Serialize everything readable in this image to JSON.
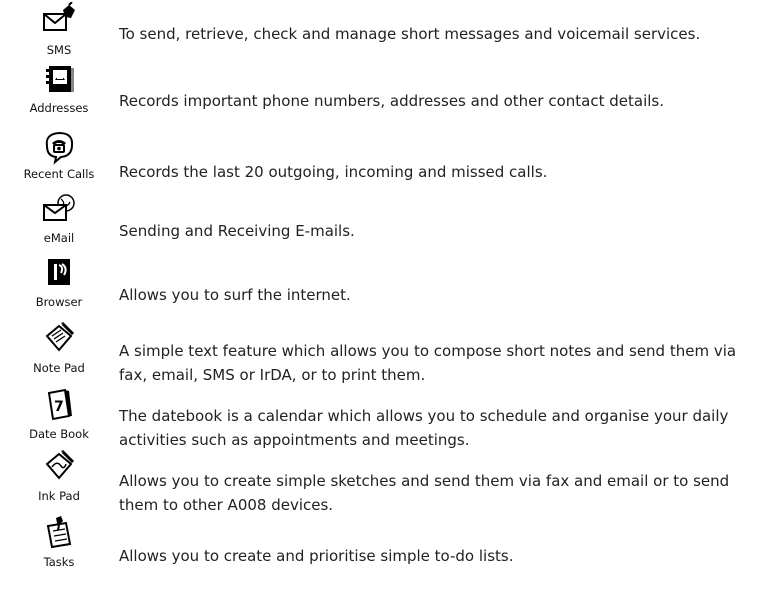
{
  "items": [
    {
      "label": "SMS",
      "icon": "sms-envelope-icon",
      "description": "To send, retrieve, check and manage short messages and voicemail services."
    },
    {
      "label": "Addresses",
      "icon": "address-book-icon",
      "description": "Records important phone numbers, addresses and other contact details."
    },
    {
      "label": "Recent Calls",
      "icon": "recent-calls-phone-icon",
      "description": "Records the last 20 outgoing, incoming and missed calls."
    },
    {
      "label": "eMail",
      "icon": "email-envelope-globe-icon",
      "description": "Sending and Receiving E-mails."
    },
    {
      "label": "Browser",
      "icon": "browser-icon",
      "description": "Allows you to surf the internet."
    },
    {
      "label": "Note Pad",
      "icon": "note-pad-icon",
      "description": "A simple text feature which allows you to compose short notes and send them via fax, email, SMS or IrDA, or to print them."
    },
    {
      "label": "Date Book",
      "icon": "date-book-icon",
      "description": "The datebook is a calendar which allows you to schedule and organise your daily activities such as appointments and meetings."
    },
    {
      "label": "Ink Pad",
      "icon": "ink-pad-icon",
      "description": "Allows you to create simple sketches and send them via fax and email or to send them to other A008 devices."
    },
    {
      "label": "Tasks",
      "icon": "tasks-icon",
      "description": "Allows you to create and prioritise simple to-do lists."
    }
  ]
}
